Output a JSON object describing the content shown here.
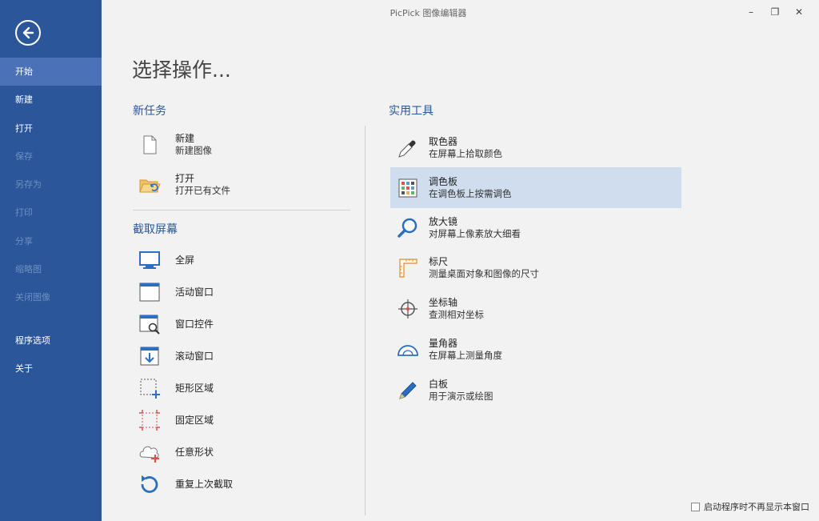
{
  "window": {
    "title": "PicPick 图像编辑器",
    "minimize": "–",
    "maximize": "❐",
    "close": "✕"
  },
  "sidebar": {
    "items": [
      {
        "label": "开始",
        "state": "active"
      },
      {
        "label": "新建",
        "state": "enabled"
      },
      {
        "label": "打开",
        "state": "enabled"
      },
      {
        "label": "保存",
        "state": "disabled"
      },
      {
        "label": "另存为",
        "state": "disabled"
      },
      {
        "label": "打印",
        "state": "disabled"
      },
      {
        "label": "分享",
        "state": "disabled"
      },
      {
        "label": "缩略图",
        "state": "disabled"
      },
      {
        "label": "关闭图像",
        "state": "disabled"
      }
    ],
    "bottom_items": [
      {
        "label": "程序选项"
      },
      {
        "label": "关于"
      }
    ]
  },
  "main": {
    "title": "选择操作...",
    "new_task": {
      "heading": "新任务",
      "items": [
        {
          "title": "新建",
          "desc": "新建图像",
          "icon": "new-file-icon"
        },
        {
          "title": "打开",
          "desc": "打开已有文件",
          "icon": "open-folder-icon"
        }
      ]
    },
    "capture": {
      "heading": "截取屏幕",
      "items": [
        {
          "title": "全屏",
          "icon": "fullscreen-icon"
        },
        {
          "title": "活动窗口",
          "icon": "active-window-icon"
        },
        {
          "title": "窗口控件",
          "icon": "window-control-icon"
        },
        {
          "title": "滚动窗口",
          "icon": "scroll-window-icon"
        },
        {
          "title": "矩形区域",
          "icon": "rect-region-icon"
        },
        {
          "title": "固定区域",
          "icon": "fixed-region-icon"
        },
        {
          "title": "任意形状",
          "icon": "freehand-icon"
        },
        {
          "title": "重复上次截取",
          "icon": "repeat-capture-icon"
        }
      ]
    },
    "tools": {
      "heading": "实用工具",
      "items": [
        {
          "title": "取色器",
          "desc": "在屏幕上拾取颜色",
          "icon": "eyedropper-icon"
        },
        {
          "title": "调色板",
          "desc": "在调色板上按需调色",
          "icon": "palette-icon",
          "highlighted": true
        },
        {
          "title": "放大镜",
          "desc": "对屏幕上像素放大细看",
          "icon": "magnifier-icon"
        },
        {
          "title": "标尺",
          "desc": "测量桌面对象和图像的尺寸",
          "icon": "ruler-icon"
        },
        {
          "title": "坐标轴",
          "desc": "查测相对坐标",
          "icon": "crosshair-icon"
        },
        {
          "title": "量角器",
          "desc": "在屏幕上测量角度",
          "icon": "protractor-icon"
        },
        {
          "title": "白板",
          "desc": "用于演示或绘图",
          "icon": "whiteboard-pen-icon"
        }
      ]
    }
  },
  "footer": {
    "startup_checkbox_label": "启动程序时不再显示本窗口",
    "startup_checked": false
  }
}
